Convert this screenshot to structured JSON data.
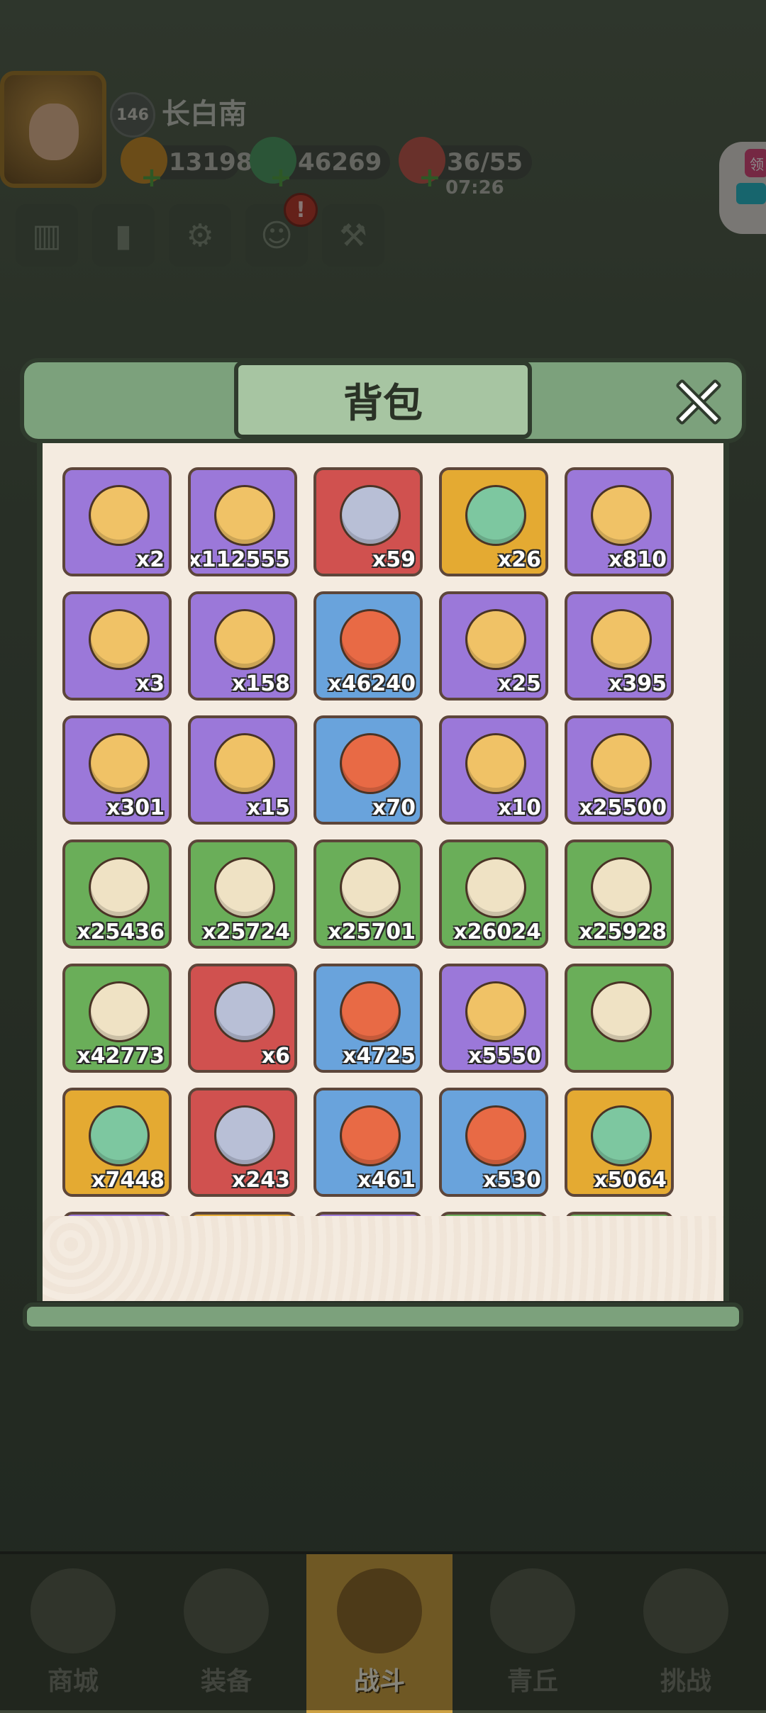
{
  "player": {
    "level": "146",
    "name": "长白南"
  },
  "resources": {
    "gold": "13198",
    "jade": "46269",
    "stamina": "36/55",
    "stamina_timer": "07:26"
  },
  "side_tag": {
    "label": "领"
  },
  "modal": {
    "title": "背包",
    "close_icon": "close-x-icon"
  },
  "inventory": {
    "items": [
      {
        "icon": "scroll-icon",
        "rarity": "purple",
        "count": "x2"
      },
      {
        "icon": "gold-coin-icon",
        "rarity": "purple",
        "count": "x112555"
      },
      {
        "icon": "rune-stone-icon",
        "rarity": "red",
        "count": "x59"
      },
      {
        "icon": "jade-feathers-icon",
        "rarity": "gold",
        "count": "x26"
      },
      {
        "icon": "silver-emblem-icon",
        "rarity": "purple",
        "count": "x810"
      },
      {
        "icon": "blue-talisman-icon",
        "rarity": "purple",
        "count": "x3"
      },
      {
        "icon": "token-pouch-icon",
        "rarity": "purple",
        "count": "x158"
      },
      {
        "icon": "heart-icon",
        "rarity": "blue",
        "count": "x46240"
      },
      {
        "icon": "key-icon",
        "rarity": "purple",
        "count": "x25"
      },
      {
        "icon": "compass-tablet-icon",
        "rarity": "purple",
        "count": "x395"
      },
      {
        "icon": "fishing-rod-icon",
        "rarity": "purple",
        "count": "x301"
      },
      {
        "icon": "wooden-staff-icon",
        "rarity": "purple",
        "count": "x15"
      },
      {
        "icon": "jade-hat-icon",
        "rarity": "blue",
        "count": "x70"
      },
      {
        "icon": "crystal-orb-icon",
        "rarity": "purple",
        "count": "x10"
      },
      {
        "icon": "sword-coin-icon",
        "rarity": "purple",
        "count": "x25500"
      },
      {
        "icon": "green-scroll-icon",
        "rarity": "green",
        "count": "x25436"
      },
      {
        "icon": "green-scroll-icon",
        "rarity": "green",
        "count": "x25724"
      },
      {
        "icon": "green-scroll-icon",
        "rarity": "green",
        "count": "x25701"
      },
      {
        "icon": "green-scroll-icon",
        "rarity": "green",
        "count": "x26024"
      },
      {
        "icon": "green-scroll-icon",
        "rarity": "green",
        "count": "x25928"
      },
      {
        "icon": "green-scroll-icon",
        "rarity": "green",
        "count": "x42773"
      },
      {
        "icon": "fire-orb-box-icon",
        "rarity": "red",
        "count": "x6"
      },
      {
        "icon": "stone-crystal-icon",
        "rarity": "blue",
        "count": "x4725"
      },
      {
        "icon": "crystal-cluster-icon",
        "rarity": "purple",
        "count": "x5550"
      },
      {
        "icon": "spirit-orb-icon",
        "rarity": "green",
        "count": ""
      },
      {
        "icon": "golden-feather-icon",
        "rarity": "gold",
        "count": "x7448"
      },
      {
        "icon": "prayer-beads-icon",
        "rarity": "red",
        "count": "x243"
      },
      {
        "icon": "meat-dish-icon",
        "rarity": "blue",
        "count": "x461"
      },
      {
        "icon": "slime-egg-icon",
        "rarity": "blue",
        "count": "x530"
      },
      {
        "icon": "points-token-icon",
        "rarity": "gold",
        "count": "x5064"
      },
      {
        "icon": "partial-item-icon",
        "rarity": "purple",
        "count": ""
      },
      {
        "icon": "partial-item-icon",
        "rarity": "gold",
        "count": ""
      },
      {
        "icon": "partial-item-icon",
        "rarity": "purple",
        "count": ""
      },
      {
        "icon": "partial-item-icon",
        "rarity": "green",
        "count": ""
      },
      {
        "icon": "partial-item-icon",
        "rarity": "green",
        "count": ""
      }
    ]
  },
  "nav": {
    "tabs": [
      {
        "label": "商城",
        "icon": "shop-icon"
      },
      {
        "label": "装备",
        "icon": "armor-icon"
      },
      {
        "label": "战斗",
        "icon": "crossed-swords-icon"
      },
      {
        "label": "青丘",
        "icon": "mountain-icon"
      },
      {
        "label": "挑战",
        "icon": "challenge-icon"
      }
    ],
    "active_index": 2
  },
  "colors": {
    "purple": "#9b78d9",
    "red": "#d0514f",
    "gold": "#e4aa32",
    "blue": "#69a3dc",
    "green": "#6aae59",
    "frame": "#2f3b2d",
    "scroll": "#7ca17c"
  }
}
